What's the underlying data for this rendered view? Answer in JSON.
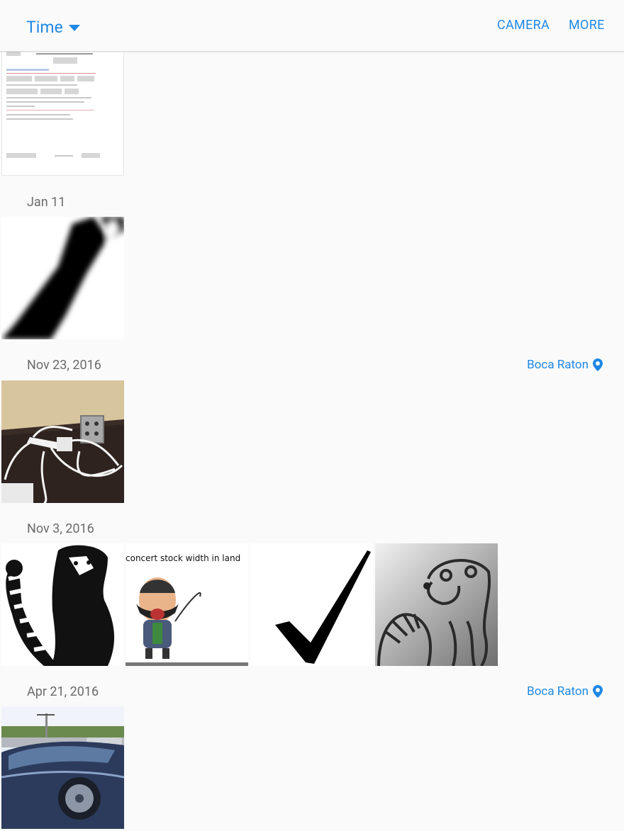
{
  "header": {
    "mode_label": "Time",
    "camera_label": "CAMERA",
    "more_label": "MORE"
  },
  "groups": [
    {
      "date": "",
      "location": ""
    },
    {
      "date": "Jan 11",
      "location": ""
    },
    {
      "date": "Nov 23, 2016",
      "location": "Boca Raton"
    },
    {
      "date": "Nov 3, 2016",
      "location": ""
    },
    {
      "date": "Apr 21, 2016",
      "location": "Boca Raton"
    }
  ],
  "thumbnails": {
    "cartoon_caption": "concert stock width in land"
  },
  "colors": {
    "accent": "#1e88e5",
    "date_text": "#6b6b6b",
    "background": "#fafafa"
  }
}
